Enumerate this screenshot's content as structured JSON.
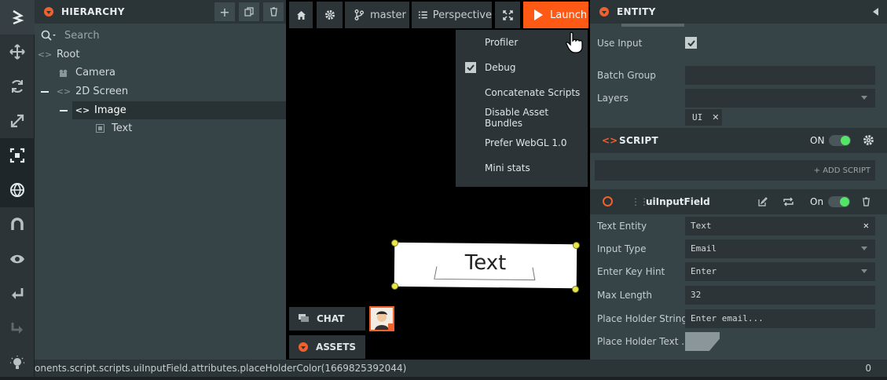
{
  "hierarchy": {
    "title": "HIERARCHY",
    "search_placeholder": "Search",
    "tree": [
      {
        "label": "Root",
        "icon": "entity-icon"
      },
      {
        "label": "Camera",
        "icon": "camera-icon"
      },
      {
        "label": "2D Screen",
        "icon": "entity-icon"
      },
      {
        "label": "Image",
        "icon": "entity-icon"
      },
      {
        "label": "Text",
        "icon": "text-element-icon"
      }
    ]
  },
  "viewport": {
    "branch": "master",
    "camera_mode": "Perspective",
    "launch_label": "Launch",
    "launch_menu": [
      {
        "label": "Profiler",
        "checked": false
      },
      {
        "label": "Debug",
        "checked": true
      },
      {
        "label": "Concatenate Scripts",
        "checked": false
      },
      {
        "label": "Disable Asset Bundles",
        "checked": false
      },
      {
        "label": "Prefer WebGL 1.0",
        "checked": false
      },
      {
        "label": "Mini stats",
        "checked": false
      }
    ],
    "canvas_text": "Text",
    "chat_label": "CHAT",
    "assets_label": "ASSETS"
  },
  "entity": {
    "title": "ENTITY",
    "use_input_label": "Use Input",
    "batch_group_label": "Batch Group",
    "layers_label": "Layers",
    "layer_tag": "UI",
    "script_section": "SCRIPT",
    "script_on": "ON",
    "add_script": "+ ADD SCRIPT",
    "script_name": "uiInputField",
    "script_state": "On",
    "attributes": [
      {
        "label": "Text Entity",
        "value": "Text"
      },
      {
        "label": "Input Type",
        "value": "Email"
      },
      {
        "label": "Enter Key Hint",
        "value": "Enter"
      },
      {
        "label": "Max Length",
        "value": "32"
      },
      {
        "label": "Place Holder String",
        "value": "Enter email..."
      },
      {
        "label": "Place Holder Text ...",
        "value": ""
      }
    ]
  },
  "status": {
    "path": "onents.script.scripts.uiInputField.attributes.placeHolderColor(1669825392044)",
    "count": "0"
  },
  "colors": {
    "accent": "#fe5a16",
    "toggle_on": "#54e466"
  }
}
